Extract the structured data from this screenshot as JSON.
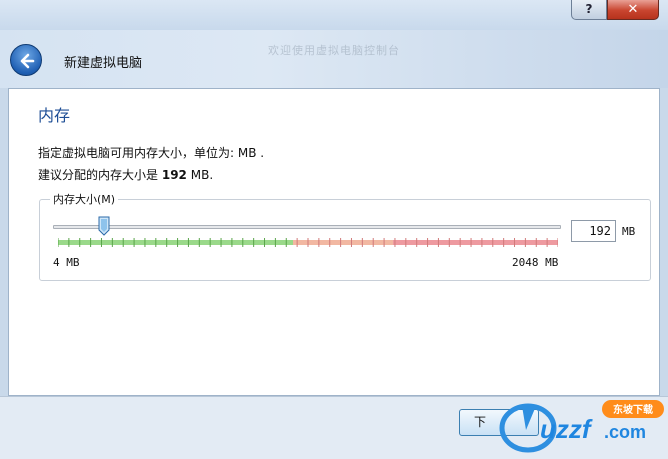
{
  "window": {
    "help_button": "?",
    "close_button": "✕"
  },
  "header": {
    "title": "新建虚拟电脑",
    "background_text": "欢迎使用虚拟电脑控制台"
  },
  "section": {
    "title": "内存",
    "description_line1": "指定虚拟电脑可用内存大小，单位为: MB .",
    "description_line2_prefix": "建议分配的内存大小是",
    "description_line2_value": "192",
    "description_line2_suffix": "MB."
  },
  "memory_group": {
    "legend": "内存大小(M)",
    "slider_min_label": "4 MB",
    "slider_max_label": "2048 MB",
    "slider_min": 4,
    "slider_max": 2048,
    "slider_value": 192,
    "input_value": "192",
    "unit": "MB",
    "safe_fraction": 0.47,
    "colors": {
      "safe": "#9ad98a",
      "warning": "#f2b8a2",
      "danger": "#ee9aa0"
    }
  },
  "footer": {
    "next_button": "下"
  },
  "watermark": {
    "text": "uzzf.com",
    "badge": "东坡下载"
  }
}
